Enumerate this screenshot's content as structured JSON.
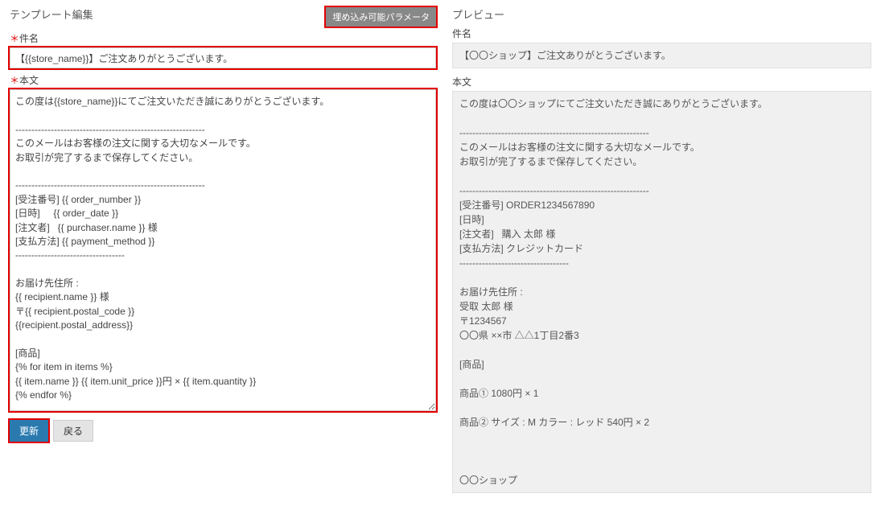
{
  "left": {
    "title": "テンプレート編集",
    "param_button": "埋め込み可能パラメータ",
    "subject_label": "件名",
    "subject_value": "【{{store_name}}】ご注文ありがとうございます。",
    "body_label": "本文",
    "body_value": "この度は{{store_name}}にてご注文いただき誠にありがとうございます。\n\n-----------------------------------------------------------\nこのメールはお客様の注文に関する大切なメールです。\nお取引が完了するまで保存してください。\n\n-----------------------------------------------------------\n[受注番号] {{ order_number }}\n[日時]     {{ order_date }}\n[注文者]   {{ purchaser.name }} 様\n[支払方法] {{ payment_method }}\n----------------------------------\n\nお届け先住所 :\n{{ recipient.name }} 様\n〒{{ recipient.postal_code }}\n{{recipient.postal_address}}\n\n[商品]\n{% for item in items %}\n{{ item.name }} {{ item.unit_price }}円 × {{ item.quantity }}\n{% endfor %}\n\n\n{{store_name}}",
    "update_button": "更新",
    "back_button": "戻る"
  },
  "right": {
    "title": "プレビュー",
    "subject_label": "件名",
    "subject_value": "【〇〇ショップ】ご注文ありがとうございます。",
    "body_label": "本文",
    "body_value": "この度は〇〇ショップにてご注文いただき誠にありがとうございます。\n\n-----------------------------------------------------------\nこのメールはお客様の注文に関する大切なメールです。\nお取引が完了するまで保存してください。\n\n-----------------------------------------------------------\n[受注番号] ORDER1234567890\n[日時]\n[注文者]   購入 太郎 様\n[支払方法] クレジットカード\n----------------------------------\n\nお届け先住所 :\n受取 太郎 様\n〒1234567\n〇〇県 ××市 △△1丁目2番3\n\n[商品]\n\n商品① 1080円 × 1\n\n商品② サイズ : M カラー : レッド 540円 × 2\n\n\n\n〇〇ショップ"
  }
}
